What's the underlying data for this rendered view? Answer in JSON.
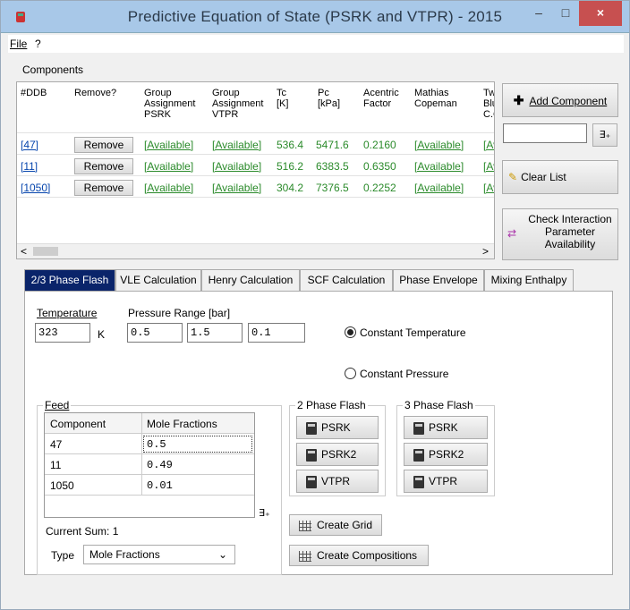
{
  "window": {
    "title": "Predictive Equation of State (PSRK and VTPR) - 2015",
    "min": "–",
    "max": "□",
    "close": "×"
  },
  "menu": {
    "file": "File",
    "help": "?"
  },
  "components": {
    "label": "Components",
    "headers": [
      "#DDB",
      "Remove?",
      "Group Assignment PSRK",
      "Group Assignment VTPR",
      "Tc [K]",
      "Pc [kPa]",
      "Acentric Factor",
      "Mathias Copeman",
      "Tw Blu C.C"
    ],
    "rows": [
      {
        "ddb": "[47]",
        "remove": "Remove",
        "psrk": "[Available]",
        "vtpr": "[Available]",
        "tc": "536.4",
        "pc": "5471.6",
        "af": "0.2160",
        "mc": "[Available]",
        "tw": "[Av"
      },
      {
        "ddb": "[11]",
        "remove": "Remove",
        "psrk": "[Available]",
        "vtpr": "[Available]",
        "tc": "516.2",
        "pc": "6383.5",
        "af": "0.6350",
        "mc": "[Available]",
        "tw": "[Av"
      },
      {
        "ddb": "[1050]",
        "remove": "Remove",
        "psrk": "[Available]",
        "vtpr": "[Available]",
        "tc": "304.2",
        "pc": "7376.5",
        "af": "0.2252",
        "mc": "[Available]",
        "tw": "[Av"
      }
    ],
    "add": "Add Component",
    "clear": "Clear List",
    "check": "Check Interaction Parameter Availability"
  },
  "tabs": [
    "2/3 Phase Flash",
    "VLE Calculation",
    "Henry Calculation",
    "SCF Calculation",
    "Phase Envelope",
    "Mixing Enthalpy"
  ],
  "flash": {
    "temp_label": "Temperature",
    "temp_value": "323",
    "temp_unit": "K",
    "pressure_label": "Pressure Range [bar]",
    "p_from": "0.5",
    "p_to": "1.5",
    "p_step": "0.1",
    "const_temp": "Constant Temperature",
    "const_pressure": "Constant Pressure",
    "feed_label": "Feed",
    "feed_headers": [
      "Component",
      "Mole Fractions"
    ],
    "feed_rows": [
      {
        "c": "47",
        "x": "0.5"
      },
      {
        "c": "11",
        "x": "0.49"
      },
      {
        "c": "1050",
        "x": "0.01"
      }
    ],
    "current_sum": "Current Sum:  1",
    "type_label": "Type",
    "type_value": "Mole Fractions",
    "two_phase": "2 Phase Flash",
    "three_phase": "3 Phase Flash",
    "psrk": "PSRK",
    "psrk2": "PSRK2",
    "vtpr": "VTPR",
    "create_grid": "Create Grid",
    "create_comp": "Create Compositions"
  }
}
